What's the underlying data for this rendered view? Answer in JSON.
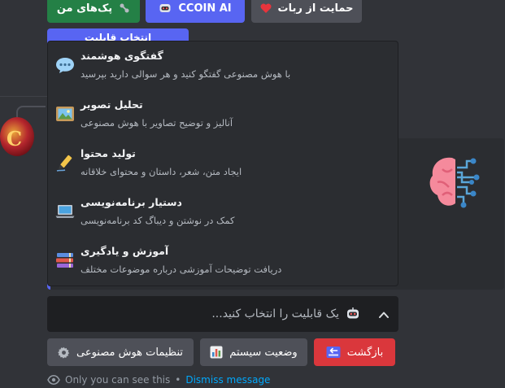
{
  "top_buttons": {
    "my_packs": "پک‌های من",
    "ccoin_ai": "CCOIN AI",
    "support": "حمایت از ربات"
  },
  "hidden_button": {
    "label": "انتخاب قابلیت"
  },
  "dropdown": {
    "options": [
      {
        "icon": "speech-bubble-icon",
        "label": "گفتگوی هوشمند",
        "description": "با هوش مصنوعی گفتگو کنید و هر سوالی دارید بپرسید"
      },
      {
        "icon": "picture-icon",
        "label": "تحلیل تصویر",
        "description": "آنالیز و توضیح تصاویر با هوش مصنوعی"
      },
      {
        "icon": "pen-icon",
        "label": "تولید محتوا",
        "description": "ایجاد متن، شعر، داستان و محتوای خلاقانه"
      },
      {
        "icon": "laptop-icon",
        "label": "دستیار برنامه‌نویسی",
        "description": "کمک در نوشتن و دیباگ کد برنامه‌نویسی"
      },
      {
        "icon": "books-icon",
        "label": "آموزش و یادگیری",
        "description": "دریافت توضیحات آموزشی درباره موضوعات مختلف"
      }
    ]
  },
  "select": {
    "placeholder": "یک قابلیت را انتخاب کنید..."
  },
  "bottom_buttons": {
    "back": "بازگشت",
    "system_status": "وضعیت سیستم",
    "ai_settings": "تنظیمات هوش مصنوعی"
  },
  "ephemeral": {
    "only_you": "Only you can see this",
    "separator": "•",
    "dismiss": "Dismiss message"
  },
  "colors": {
    "background": "#313338",
    "green": "#248046",
    "blurple": "#5865f2",
    "grey": "#4e5058",
    "red": "#da373c",
    "link": "#00a8fc"
  }
}
